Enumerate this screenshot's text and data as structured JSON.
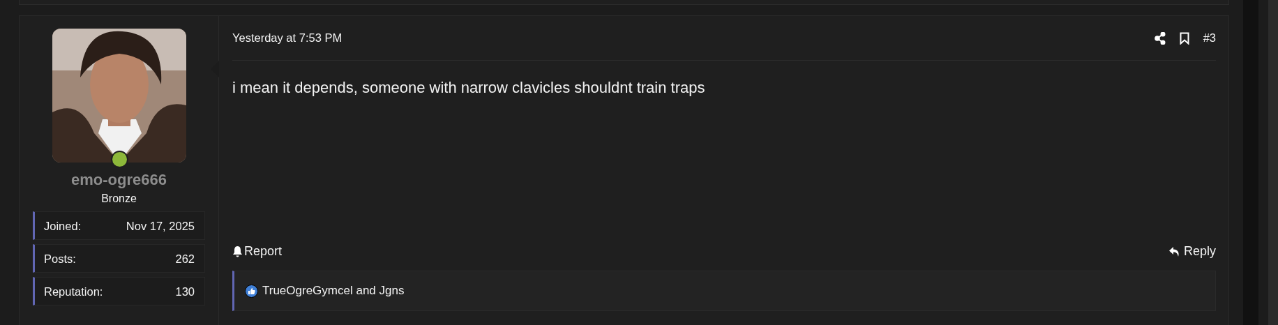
{
  "user": {
    "online": true,
    "username": "emo-ogre666",
    "title": "Bronze",
    "stats": [
      {
        "label": "Joined:",
        "value": "Nov 17, 2025"
      },
      {
        "label": "Posts:",
        "value": "262"
      },
      {
        "label": "Reputation:",
        "value": "130"
      }
    ]
  },
  "post": {
    "date": "Yesterday at 7:53 PM",
    "number": "#3",
    "message": "i mean it depends, someone with narrow clavicles shouldnt train traps",
    "report": "Report",
    "reply": "Reply",
    "reactions": "TrueOgreGymcel and Jgns"
  }
}
